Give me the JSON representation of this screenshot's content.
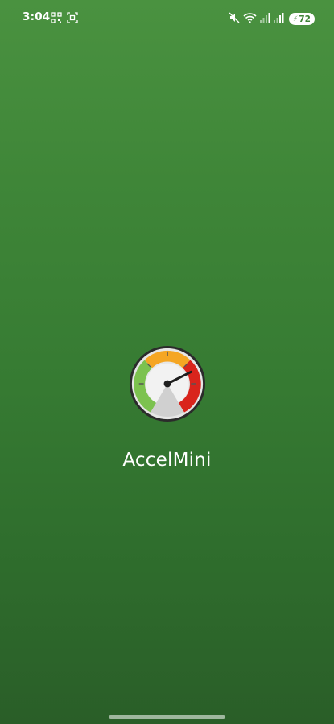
{
  "status_bar": {
    "time": "3:04",
    "battery_level": "72",
    "left_icons": [
      "qr-scan-icon",
      "screenshot-icon"
    ],
    "right_icons": [
      "mute-icon",
      "wifi-icon",
      "signal-icon",
      "signal-icon",
      "battery-icon"
    ]
  },
  "splash": {
    "app_name": "AccelMini",
    "logo_icon": "speedometer-icon"
  },
  "colors": {
    "background_top": "#4a9240",
    "background_bottom": "#2a5e28",
    "gauge_green": "#7cc24f",
    "gauge_orange": "#f5a623",
    "gauge_red": "#d9241c"
  }
}
